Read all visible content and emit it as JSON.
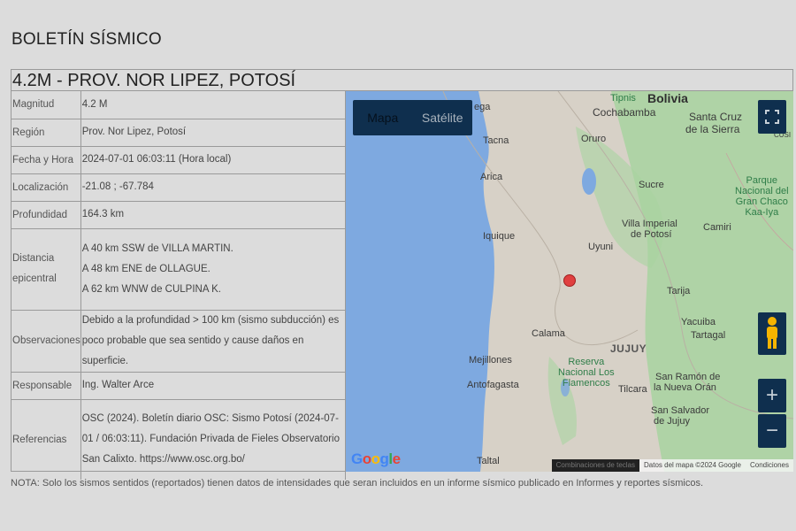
{
  "page": {
    "title": "BOLETÍN SÍSMICO"
  },
  "event": {
    "title": "4.2M - PROV. NOR LIPEZ, POTOSÍ"
  },
  "rows": {
    "magnitude": {
      "label": "Magnitud",
      "value": "4.2 M"
    },
    "region": {
      "label": "Región",
      "value": "Prov. Nor Lipez, Potosí"
    },
    "datetime": {
      "label": "Fecha y Hora",
      "value": "2024-07-01 06:03:11 (Hora local)"
    },
    "location": {
      "label": "Localización",
      "value": "-21.08 ; -67.784"
    },
    "depth": {
      "label": "Profundidad",
      "value": "164.3 km"
    },
    "distance": {
      "label": "Distancia epicentral",
      "lines": [
        "A 40 km SSW de VILLA MARTIN.",
        "A 48 km ENE de OLLAGUE.",
        "A 62 km WNW de CULPINA K."
      ]
    },
    "observations": {
      "label": "Observaciones",
      "value": "Debido a la profundidad > 100 km (sismo subducción) es poco probable que sea sentido y cause daños en superficie."
    },
    "responsible": {
      "label": "Responsable",
      "value": "Ing. Walter Arce"
    },
    "references": {
      "label": "Referencias",
      "value": "OSC (2024). Boletín diario OSC: Sismo Potosí (2024-07-01 / 06:03:11). Fundación Privada de Fieles Observatorio San Calixto. https://www.osc.org.bo/"
    }
  },
  "map": {
    "map_type_options": [
      "Mapa",
      "Satélite"
    ],
    "selected_map_type": "Mapa",
    "colors": {
      "ocean": "#7ea9e0",
      "land": "#d7d1c7",
      "green": "#a8d4a0",
      "control": "#0f2f4e",
      "epicenter": "#e04040"
    },
    "labels": {
      "bolivia": "Bolivia",
      "tipnis": "Tipnis",
      "cochabamba": "Cochabamba",
      "santa_cruz": "Santa Cruz",
      "de_la_sierra": "de la Sierra",
      "parque": "Parque",
      "nacional_del": "Nacional del",
      "gran_chaco": "Gran Chaco",
      "kaa_iya": "Kaa-Iya",
      "tacna": "Tacna",
      "oruro": "Oruro",
      "arica": "Arica",
      "sucre": "Sucre",
      "villa_imperial": "Villa Imperial",
      "de_potosi": "de Potosí",
      "camiri": "Camiri",
      "iquique": "Iquique",
      "uyuni": "Uyuni",
      "tarija": "Tarija",
      "yacuiba": "Yacuiba",
      "tartagal": "Tartagal",
      "calama": "Calama",
      "mejillones": "Mejillones",
      "jujuy": "JUJUY",
      "reserva": "Reserva",
      "nacional_los": "Nacional Los",
      "flamencos": "Flamencos",
      "antofagasta": "Antofagasta",
      "tilcara": "Tilcara",
      "san_ramon": "San Ramón de",
      "nueva_oran": "la Nueva Orán",
      "san_salvador": "San Salvador",
      "de_jujuy": "de Jujuy",
      "taltal": "Taltal",
      "ega": "ega",
      "cusi": "CUSI"
    },
    "zoom_in": "+",
    "zoom_out": "−",
    "fullscreen_icon": "fullscreen-icon",
    "pegman_icon": "pegman-icon",
    "google_logo": "Google",
    "attribution": {
      "keyboard": "Combinaciones de teclas",
      "data": "Datos del mapa ©2024 Google",
      "terms": "Condiciones"
    }
  },
  "note": "NOTA: Solo los sismos sentidos (reportados) tienen datos de intensidades que seran incluidos en un informe sísmico publicado en Informes y reportes sísmicos."
}
